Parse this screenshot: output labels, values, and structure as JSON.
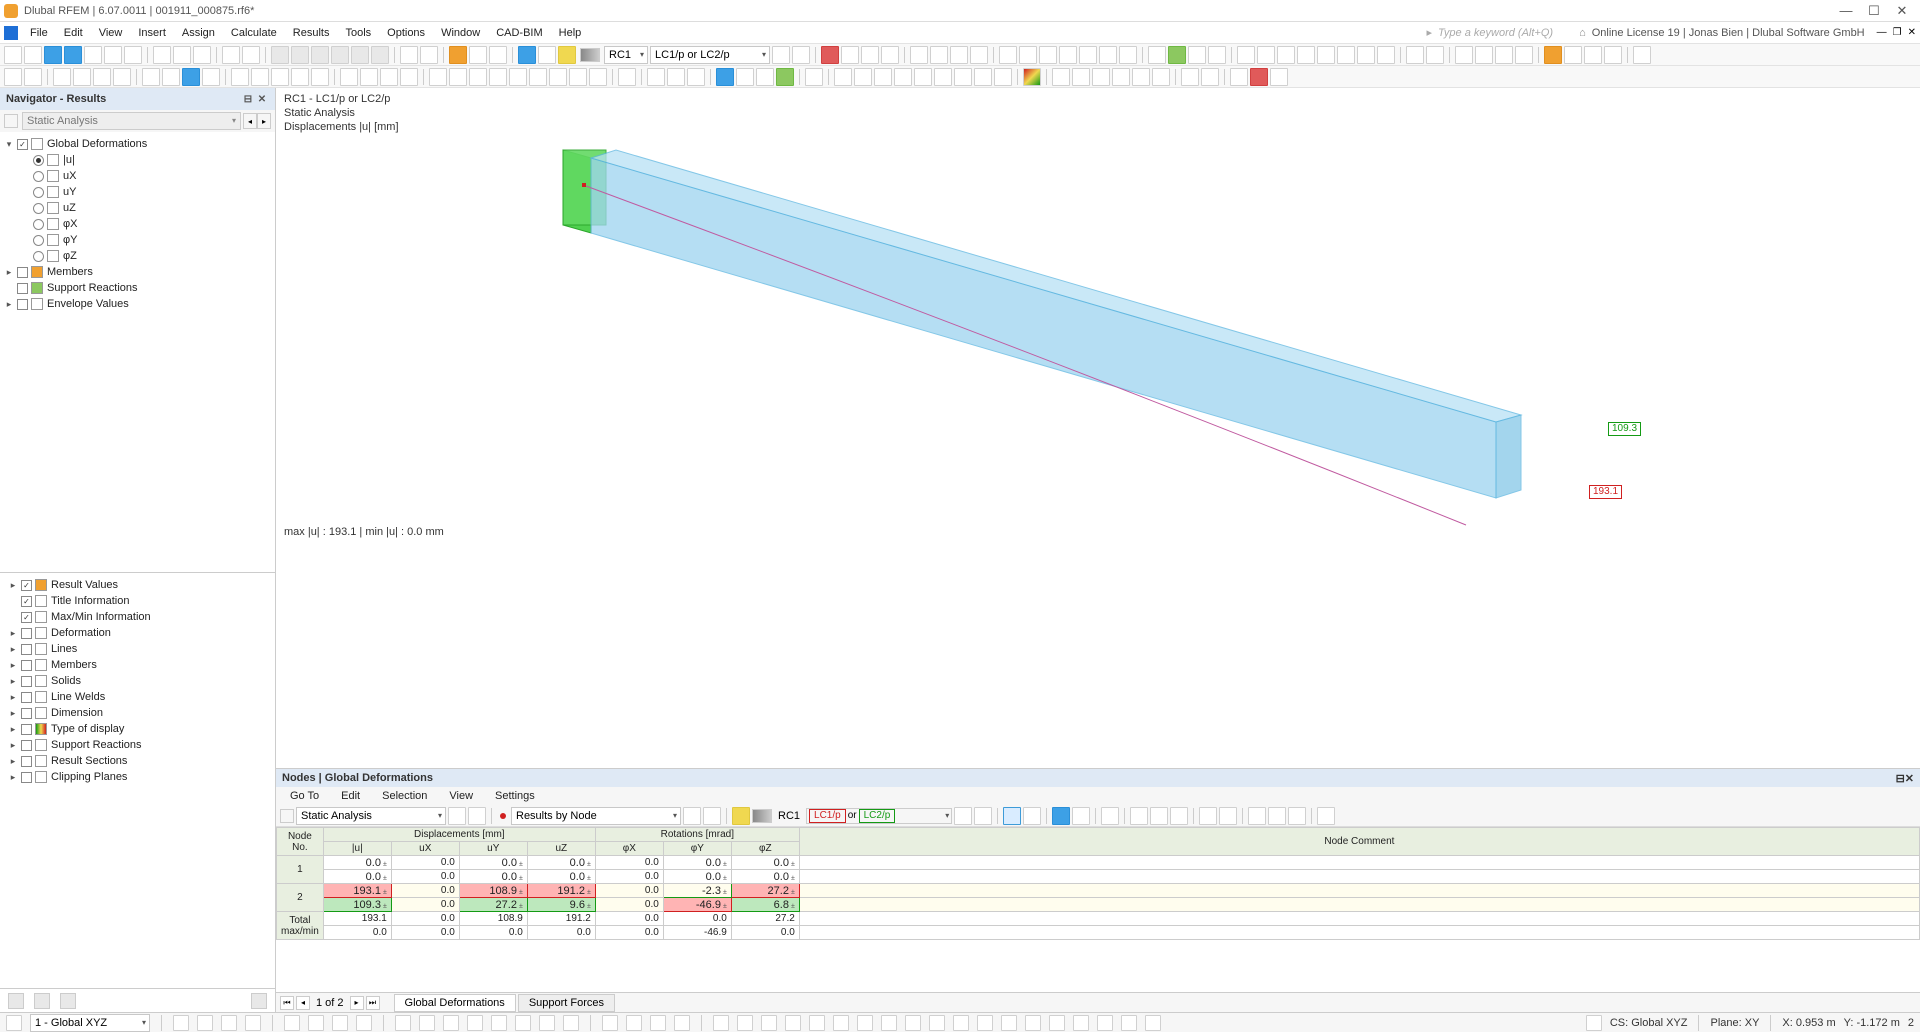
{
  "app": {
    "title": "Dlubal RFEM | 6.07.0011 | 001911_000875.rf6*"
  },
  "menubar": {
    "items": [
      "File",
      "Edit",
      "View",
      "Insert",
      "Assign",
      "Calculate",
      "Results",
      "Tools",
      "Options",
      "Window",
      "CAD-BIM",
      "Help"
    ],
    "search_placeholder": "Type a keyword (Alt+Q)",
    "license": "Online License 19 | Jonas Bien | Dlubal Software GmbH"
  },
  "toolbar1": {
    "combo_rc": "RC1",
    "combo_lc": "LC1/p or LC2/p"
  },
  "navigator": {
    "title": "Navigator - Results",
    "analysis": "Static Analysis",
    "tree1": {
      "global_def": "Global Deformations",
      "u": "|u|",
      "ux": "uX",
      "uy": "uY",
      "uz": "uZ",
      "phix": "φX",
      "phiy": "φY",
      "phiz": "φZ",
      "members": "Members",
      "support": "Support Reactions",
      "envelope": "Envelope Values"
    },
    "tree2": [
      "Result Values",
      "Title Information",
      "Max/Min Information",
      "Deformation",
      "Lines",
      "Members",
      "Solids",
      "Line Welds",
      "Dimension",
      "Type of display",
      "Support Reactions",
      "Result Sections",
      "Clipping Planes"
    ]
  },
  "viewport": {
    "line1": "RC1 - LC1/p or LC2/p",
    "line2": "Static Analysis",
    "line3": "Displacements |u| [mm]",
    "bottom": "max |u| : 193.1 | min |u| : 0.0 mm",
    "label_green": "109.3",
    "label_red": "193.1"
  },
  "bottom_panel": {
    "title": "Nodes | Global Deformations",
    "menu": [
      "Go To",
      "Edit",
      "Selection",
      "View",
      "Settings"
    ],
    "analysis": "Static Analysis",
    "results_by": "Results by Node",
    "rc": "RC1",
    "lc1": "LC1/p",
    "lc_or": "or",
    "lc2": "LC2/p",
    "disp_header": "Displacements [mm]",
    "rot_header": "Rotations [mrad]",
    "cols": {
      "node": "Node\nNo.",
      "u": "|u|",
      "ux": "uX",
      "uy": "uY",
      "uz": "uZ",
      "phix": "φX",
      "phiy": "φY",
      "phiz": "φZ",
      "comment": "Node Comment"
    },
    "rows": [
      {
        "no": "1",
        "u": "0.0",
        "ux": "0.0",
        "uy": "0.0",
        "uz": "0.0",
        "phix": "0.0",
        "phiy": "0.0",
        "phiz": "0.0"
      },
      {
        "no": "",
        "u": "0.0",
        "ux": "0.0",
        "uy": "0.0",
        "uz": "0.0",
        "phix": "0.0",
        "phiy": "0.0",
        "phiz": "0.0"
      },
      {
        "no": "2",
        "u": "193.1",
        "ux": "0.0",
        "uy": "108.9",
        "uz": "191.2",
        "phix": "0.0",
        "phiy": "-2.3",
        "phiz": "27.2"
      },
      {
        "no": "",
        "u": "109.3",
        "ux": "0.0",
        "uy": "27.2",
        "uz": "9.6",
        "phix": "0.0",
        "phiy": "-46.9",
        "phiz": "6.8"
      }
    ],
    "totals": {
      "label": "Total\nmax/min",
      "max": {
        "u": "193.1",
        "ux": "0.0",
        "uy": "108.9",
        "uz": "191.2",
        "phix": "0.0",
        "phiy": "0.0",
        "phiz": "27.2"
      },
      "min": {
        "u": "0.0",
        "ux": "0.0",
        "uy": "0.0",
        "uz": "0.0",
        "phix": "0.0",
        "phiy": "-46.9",
        "phiz": "0.0"
      }
    },
    "pager": "1 of 2",
    "tabs": [
      "Global Deformations",
      "Support Forces"
    ]
  },
  "statusbar": {
    "cs_combo": "1 - Global XYZ",
    "cs": "CS: Global XYZ",
    "plane": "Plane: XY",
    "x": "X: 0.953 m",
    "y": "Y: -1.172 m",
    "z": "2"
  }
}
